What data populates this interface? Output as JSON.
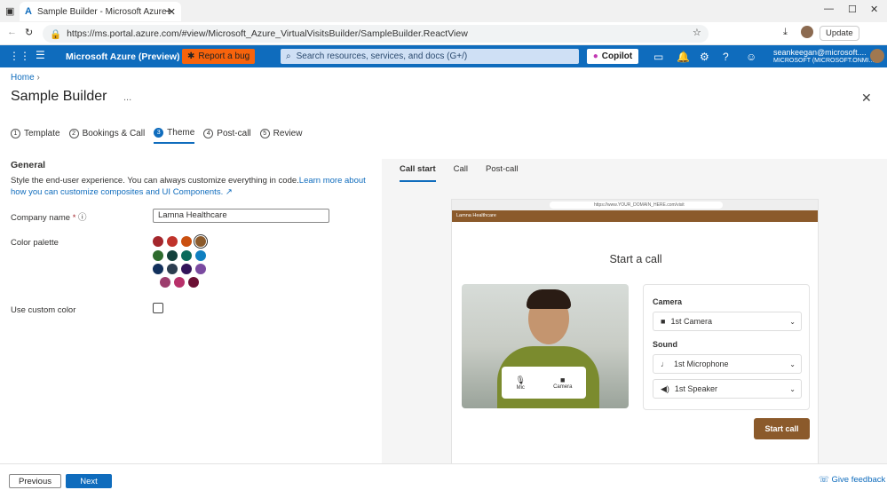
{
  "browser": {
    "tab_title": "Sample Builder - Microsoft Azure",
    "url": "https://ms.portal.azure.com/#view/Microsoft_Azure_VirtualVisitsBuilder/SampleBuilder.ReactView",
    "update_label": "Update"
  },
  "azure": {
    "brand": "Microsoft Azure (Preview)",
    "bug_label": "Report a bug",
    "search_placeholder": "Search resources, services, and docs (G+/)",
    "copilot_label": "Copilot",
    "user_email": "seankeegan@microsoft....",
    "user_tenant": "MICROSOFT (MICROSOFT.ONMI..."
  },
  "page": {
    "breadcrumb": "Home",
    "title": "Sample Builder",
    "more": "...",
    "close": "✕"
  },
  "steps": [
    {
      "num": "1",
      "label": "Template"
    },
    {
      "num": "2",
      "label": "Bookings & Call"
    },
    {
      "num": "3",
      "label": "Theme"
    },
    {
      "num": "4",
      "label": "Post-call"
    },
    {
      "num": "5",
      "label": "Review"
    }
  ],
  "general": {
    "heading": "General",
    "desc": "Style the end-user experience. You can always customize everything in code.",
    "link": "Learn more about how you can customize composites and UI Components.",
    "company_label": "Company name",
    "required": "*",
    "company_value": "Lamna Healthcare",
    "palette_label": "Color palette",
    "custom_label": "Use custom color"
  },
  "palette": [
    "#a4262c",
    "#c0332b",
    "#ca5010",
    "#8b5a2b",
    "#2e6b2e",
    "#13403b",
    "#0b6a5b",
    "#0f7fc0",
    "#12305c",
    "#2c3e50",
    "#32145a",
    "#7a4aa0",
    "#9c3d6d",
    "#b8306a",
    "#6b1034"
  ],
  "preview": {
    "tabs": [
      "Call start",
      "Call",
      "Post-call"
    ],
    "url": "https://www.YOUR_DOMAIN_HERE.com/visit",
    "brand": "Lamna Healthcare",
    "title": "Start a call",
    "mic": "Mic",
    "camera": "Camera",
    "camera_heading": "Camera",
    "camera_value": "1st Camera",
    "sound_heading": "Sound",
    "mic_value": "1st Microphone",
    "speaker_value": "1st Speaker",
    "start_button": "Start call"
  },
  "footer": {
    "previous": "Previous",
    "next": "Next",
    "feedback": "Give feedback"
  }
}
